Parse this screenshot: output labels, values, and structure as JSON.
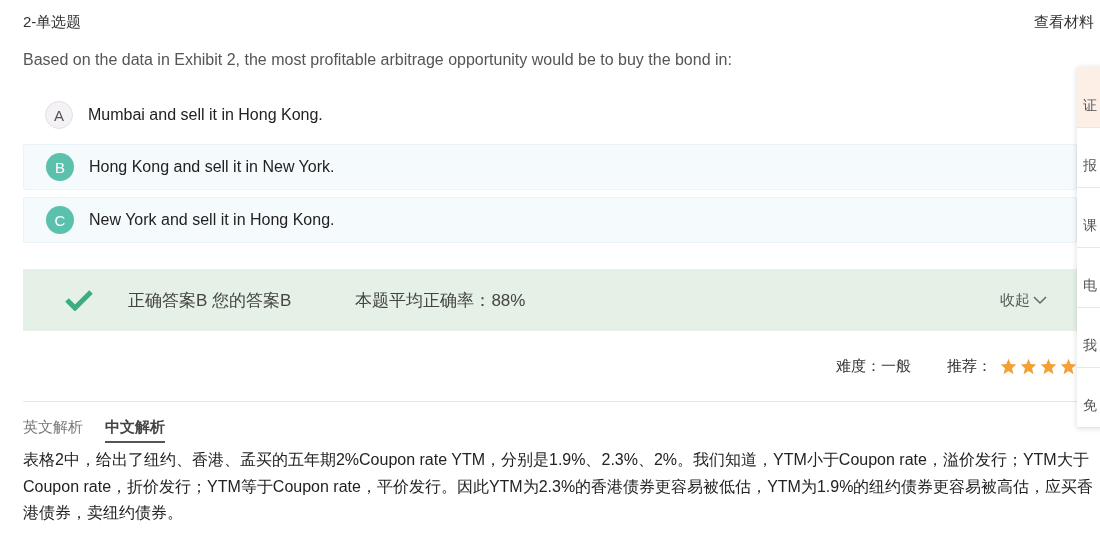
{
  "question": {
    "type_label": "2-单选题",
    "material_link": "查看材料",
    "stem": "Based on the data in Exhibit 2, the most profitable arbitrage opportunity would be to buy the bond in:"
  },
  "options": [
    {
      "letter": "A",
      "text": "Mumbai and sell it in Hong Kong.",
      "highlighted": false
    },
    {
      "letter": "B",
      "text": "Hong Kong and sell it in New York.",
      "highlighted": true
    },
    {
      "letter": "C",
      "text": "New York and sell it in Hong Kong.",
      "highlighted": true
    }
  ],
  "result": {
    "correct": true,
    "answer_text": "正确答案B 您的答案B",
    "accuracy": "本题平均正确率：88%",
    "collapse": "收起"
  },
  "rating": {
    "difficulty": "难度：一般",
    "recommend_label": "推荐：",
    "stars": 4
  },
  "analysis_tabs": [
    {
      "label": "英文解析",
      "selected": false
    },
    {
      "label": "中文解析",
      "selected": true
    }
  ],
  "analysis_text": "表格2中，给出了纽约、香港、孟买的五年期2%Coupon rate YTM，分别是1.9%、2.3%、2%。我们知道，YTM小于Coupon rate，溢价发行；YTM大于Coupon rate，折价发行；YTM等于Coupon rate，平价发行。因此YTM为2.3%的香港债券更容易被低估，YTM为1.9%的纽约债券更容易被高估，应买香港债券，卖纽约债券。",
  "side_panel": [
    {
      "label": "证",
      "selected": true
    },
    {
      "label": "报",
      "selected": false
    },
    {
      "label": "课",
      "selected": false
    },
    {
      "label": "电",
      "selected": false
    },
    {
      "label": "我",
      "selected": false
    },
    {
      "label": "免",
      "selected": false
    }
  ]
}
